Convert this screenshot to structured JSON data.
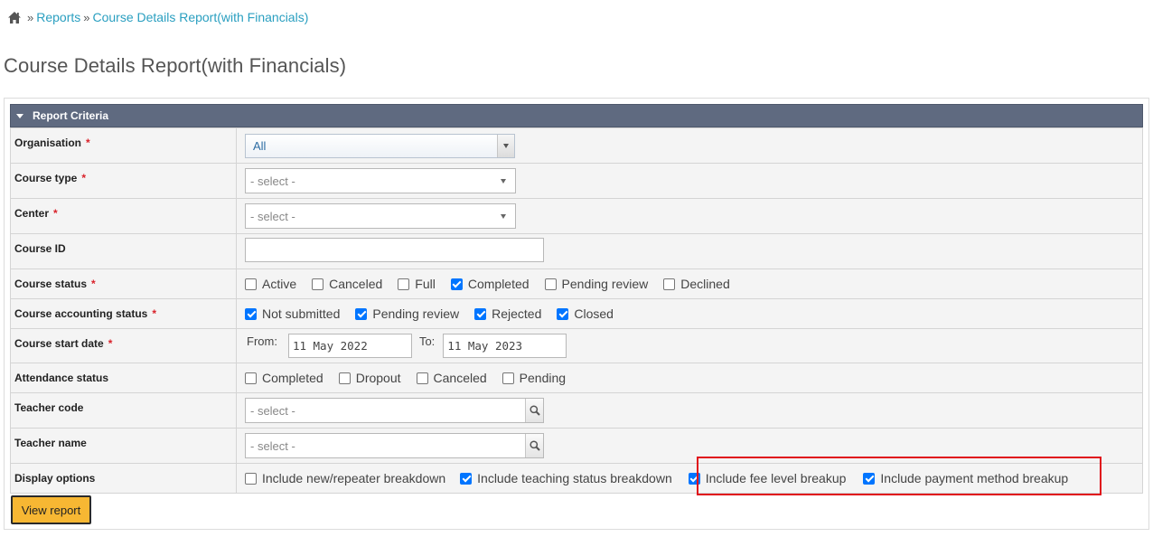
{
  "breadcrumb": {
    "home_icon": "home-icon",
    "separator": "»",
    "items": [
      "Reports",
      "Course Details Report(with Financials)"
    ]
  },
  "page_title": "Course Details Report(with Financials)",
  "panel": {
    "title": "Report Criteria",
    "header_color": "#5f6a80"
  },
  "required_mark": "*",
  "rows": {
    "organisation": {
      "label": "Organisation",
      "value": "All"
    },
    "course_type": {
      "label": "Course type",
      "value": "- select -"
    },
    "center": {
      "label": "Center",
      "value": "- select -"
    },
    "course_id": {
      "label": "Course ID",
      "value": ""
    },
    "course_status": {
      "label": "Course status",
      "options": [
        {
          "label": "Active",
          "checked": false
        },
        {
          "label": "Canceled",
          "checked": false
        },
        {
          "label": "Full",
          "checked": false
        },
        {
          "label": "Completed",
          "checked": true
        },
        {
          "label": "Pending review",
          "checked": false
        },
        {
          "label": "Declined",
          "checked": false
        }
      ]
    },
    "accounting_status": {
      "label": "Course accounting status",
      "options": [
        {
          "label": "Not submitted",
          "checked": true
        },
        {
          "label": "Pending review",
          "checked": true
        },
        {
          "label": "Rejected",
          "checked": true
        },
        {
          "label": "Closed",
          "checked": true
        }
      ]
    },
    "start_date": {
      "label": "Course start date",
      "from_label": "From:",
      "from_value": "11 May 2022",
      "to_label": "To:",
      "to_value": "11 May 2023"
    },
    "attendance_status": {
      "label": "Attendance status",
      "options": [
        {
          "label": "Completed",
          "checked": false
        },
        {
          "label": "Dropout",
          "checked": false
        },
        {
          "label": "Canceled",
          "checked": false
        },
        {
          "label": "Pending",
          "checked": false
        }
      ]
    },
    "teacher_code": {
      "label": "Teacher code",
      "value": "- select -"
    },
    "teacher_name": {
      "label": "Teacher name",
      "value": "- select -"
    },
    "display_options": {
      "label": "Display options",
      "options": [
        {
          "label": "Include new/repeater breakdown",
          "checked": false
        },
        {
          "label": "Include teaching status breakdown",
          "checked": true
        },
        {
          "label": "Include fee level breakup",
          "checked": true
        },
        {
          "label": "Include payment method breakup",
          "checked": true
        }
      ]
    }
  },
  "view_button": "View report",
  "colors": {
    "link": "#2a9fc0",
    "required": "#d9222a",
    "checkbox": "#0075ff",
    "highlight": "#e0101b",
    "button": "#f7b733"
  }
}
